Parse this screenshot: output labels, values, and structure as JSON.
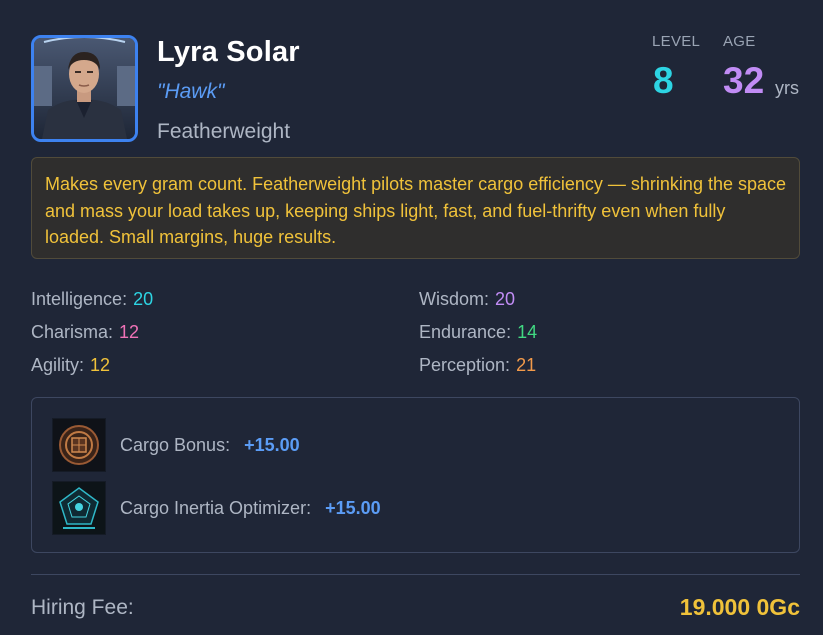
{
  "pilot": {
    "name": "Lyra Solar",
    "callsign": "\"Hawk\"",
    "perk": "Featherweight",
    "level_label": "LEVEL",
    "level": "8",
    "age_label": "AGE",
    "age": "32",
    "age_unit": "yrs",
    "description": "Makes every gram count. Featherweight pilots master cargo efficiency — shrinking the space and mass your load takes up, keeping ships light, fast, and fuel-thrifty even when fully loaded. Small margins, huge results."
  },
  "attributes": [
    {
      "label": "Intelligence:",
      "value": "20",
      "color": "#2dd4e3"
    },
    {
      "label": "Wisdom:",
      "value": "20",
      "color": "#c18cf5"
    },
    {
      "label": "Charisma:",
      "value": "12",
      "color": "#f072b7"
    },
    {
      "label": "Endurance:",
      "value": "14",
      "color": "#41d982"
    },
    {
      "label": "Agility:",
      "value": "12",
      "color": "#f0c23a"
    },
    {
      "label": "Perception:",
      "value": "21",
      "color": "#f29a4a"
    }
  ],
  "bonuses": [
    {
      "label": "Cargo Bonus:",
      "value": "+15.00",
      "icon": "cargo-bonus-icon"
    },
    {
      "label": "Cargo Inertia Optimizer:",
      "value": "+15.00",
      "icon": "cargo-inertia-optimizer-icon"
    }
  ],
  "hiring": {
    "label": "Hiring Fee:",
    "value": "19.000 0Gc"
  },
  "colors": {
    "background": "#1f2637",
    "accent_blue": "#5b9cf5",
    "gold": "#f0c23a"
  }
}
